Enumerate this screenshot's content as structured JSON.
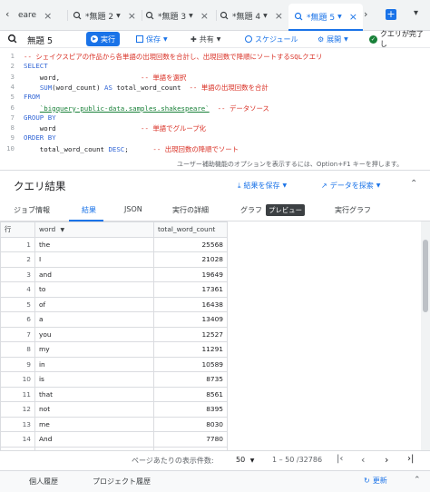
{
  "tabs": [
    {
      "label": "eare",
      "active": false
    },
    {
      "label": "*無題 2",
      "active": false
    },
    {
      "label": "*無題 3",
      "active": false
    },
    {
      "label": "*無題 4",
      "active": false
    },
    {
      "label": "*無題 5",
      "active": true
    }
  ],
  "toolbar": {
    "title": "無題 5",
    "run": "実行",
    "save": "保存",
    "share": "共有",
    "schedule": "スケジュール",
    "expand": "展開",
    "status": "クエリが完了し"
  },
  "editor": {
    "lines": [
      {
        "n": "1",
        "parts": [
          {
            "t": "-- シェイクスピアの作品から各単語の出現回数を合計し、出現回数で降順にソートするSQLクエリ",
            "c": "cm"
          }
        ]
      },
      {
        "n": "2",
        "parts": [
          {
            "t": "SELECT",
            "c": "kw"
          }
        ]
      },
      {
        "n": "3",
        "parts": [
          {
            "t": "    word,                    ",
            "c": ""
          },
          {
            "t": "-- 単語を選択",
            "c": "cm"
          }
        ]
      },
      {
        "n": "4",
        "parts": [
          {
            "t": "    ",
            "c": ""
          },
          {
            "t": "SUM",
            "c": "fn"
          },
          {
            "t": "(word_count) ",
            "c": ""
          },
          {
            "t": "AS",
            "c": "kw"
          },
          {
            "t": " total_word_count  ",
            "c": ""
          },
          {
            "t": "-- 単語の出現回数を合計",
            "c": "cm"
          }
        ]
      },
      {
        "n": "5",
        "parts": [
          {
            "t": "FROM",
            "c": "kw"
          }
        ]
      },
      {
        "n": "6",
        "parts": [
          {
            "t": "    ",
            "c": ""
          },
          {
            "t": "`bigquery-public-data.samples.shakespeare`",
            "c": "str"
          },
          {
            "t": "  ",
            "c": ""
          },
          {
            "t": "-- データソース",
            "c": "cm"
          }
        ]
      },
      {
        "n": "7",
        "parts": [
          {
            "t": "GROUP BY",
            "c": "kw"
          }
        ]
      },
      {
        "n": "8",
        "parts": [
          {
            "t": "    word                     ",
            "c": ""
          },
          {
            "t": "-- 単語でグループ化",
            "c": "cm"
          }
        ]
      },
      {
        "n": "9",
        "parts": [
          {
            "t": "ORDER BY",
            "c": "kw"
          }
        ]
      },
      {
        "n": "10",
        "parts": [
          {
            "t": "    total_word_count ",
            "c": ""
          },
          {
            "t": "DESC",
            "c": "kw"
          },
          {
            "t": ";      ",
            "c": ""
          },
          {
            "t": "-- 出現回数の降順でソート",
            "c": "cm"
          }
        ]
      }
    ],
    "hint": "ユーザー補助機能のオプションを表示するには、Option+F1 キーを押します。"
  },
  "results": {
    "title": "クエリ結果",
    "save_results": "結果を保存",
    "explore_data": "データを探索",
    "tabs": [
      "ジョブ情報",
      "結果",
      "JSON",
      "実行の詳細",
      "グラフ",
      "実行グラフ"
    ],
    "preview_badge": "プレビュー",
    "active_tab": "結果"
  },
  "table": {
    "headers": {
      "row": "行",
      "word": "word",
      "count": "total_word_count"
    },
    "rows": [
      {
        "n": "1",
        "word": "the",
        "count": "25568"
      },
      {
        "n": "2",
        "word": "I",
        "count": "21028"
      },
      {
        "n": "3",
        "word": "and",
        "count": "19649"
      },
      {
        "n": "4",
        "word": "to",
        "count": "17361"
      },
      {
        "n": "5",
        "word": "of",
        "count": "16438"
      },
      {
        "n": "6",
        "word": "a",
        "count": "13409"
      },
      {
        "n": "7",
        "word": "you",
        "count": "12527"
      },
      {
        "n": "8",
        "word": "my",
        "count": "11291"
      },
      {
        "n": "9",
        "word": "in",
        "count": "10589"
      },
      {
        "n": "10",
        "word": "is",
        "count": "8735"
      },
      {
        "n": "11",
        "word": "that",
        "count": "8561"
      },
      {
        "n": "12",
        "word": "not",
        "count": "8395"
      },
      {
        "n": "13",
        "word": "me",
        "count": "8030"
      },
      {
        "n": "14",
        "word": "And",
        "count": "7780"
      },
      {
        "n": "15",
        "word": "with",
        "count": "7224"
      }
    ]
  },
  "pager": {
    "per_page_label": "ページあたりの表示件数:",
    "per_page": "50",
    "range": "1 – 50 /32786"
  },
  "footer": {
    "personal_history": "個人履歴",
    "project_history": "プロジェクト履歴",
    "refresh": "更新"
  },
  "colors": {
    "accent": "#1a73e8",
    "comment": "#d93025",
    "keyword": "#3367d6",
    "string": "#188038"
  }
}
